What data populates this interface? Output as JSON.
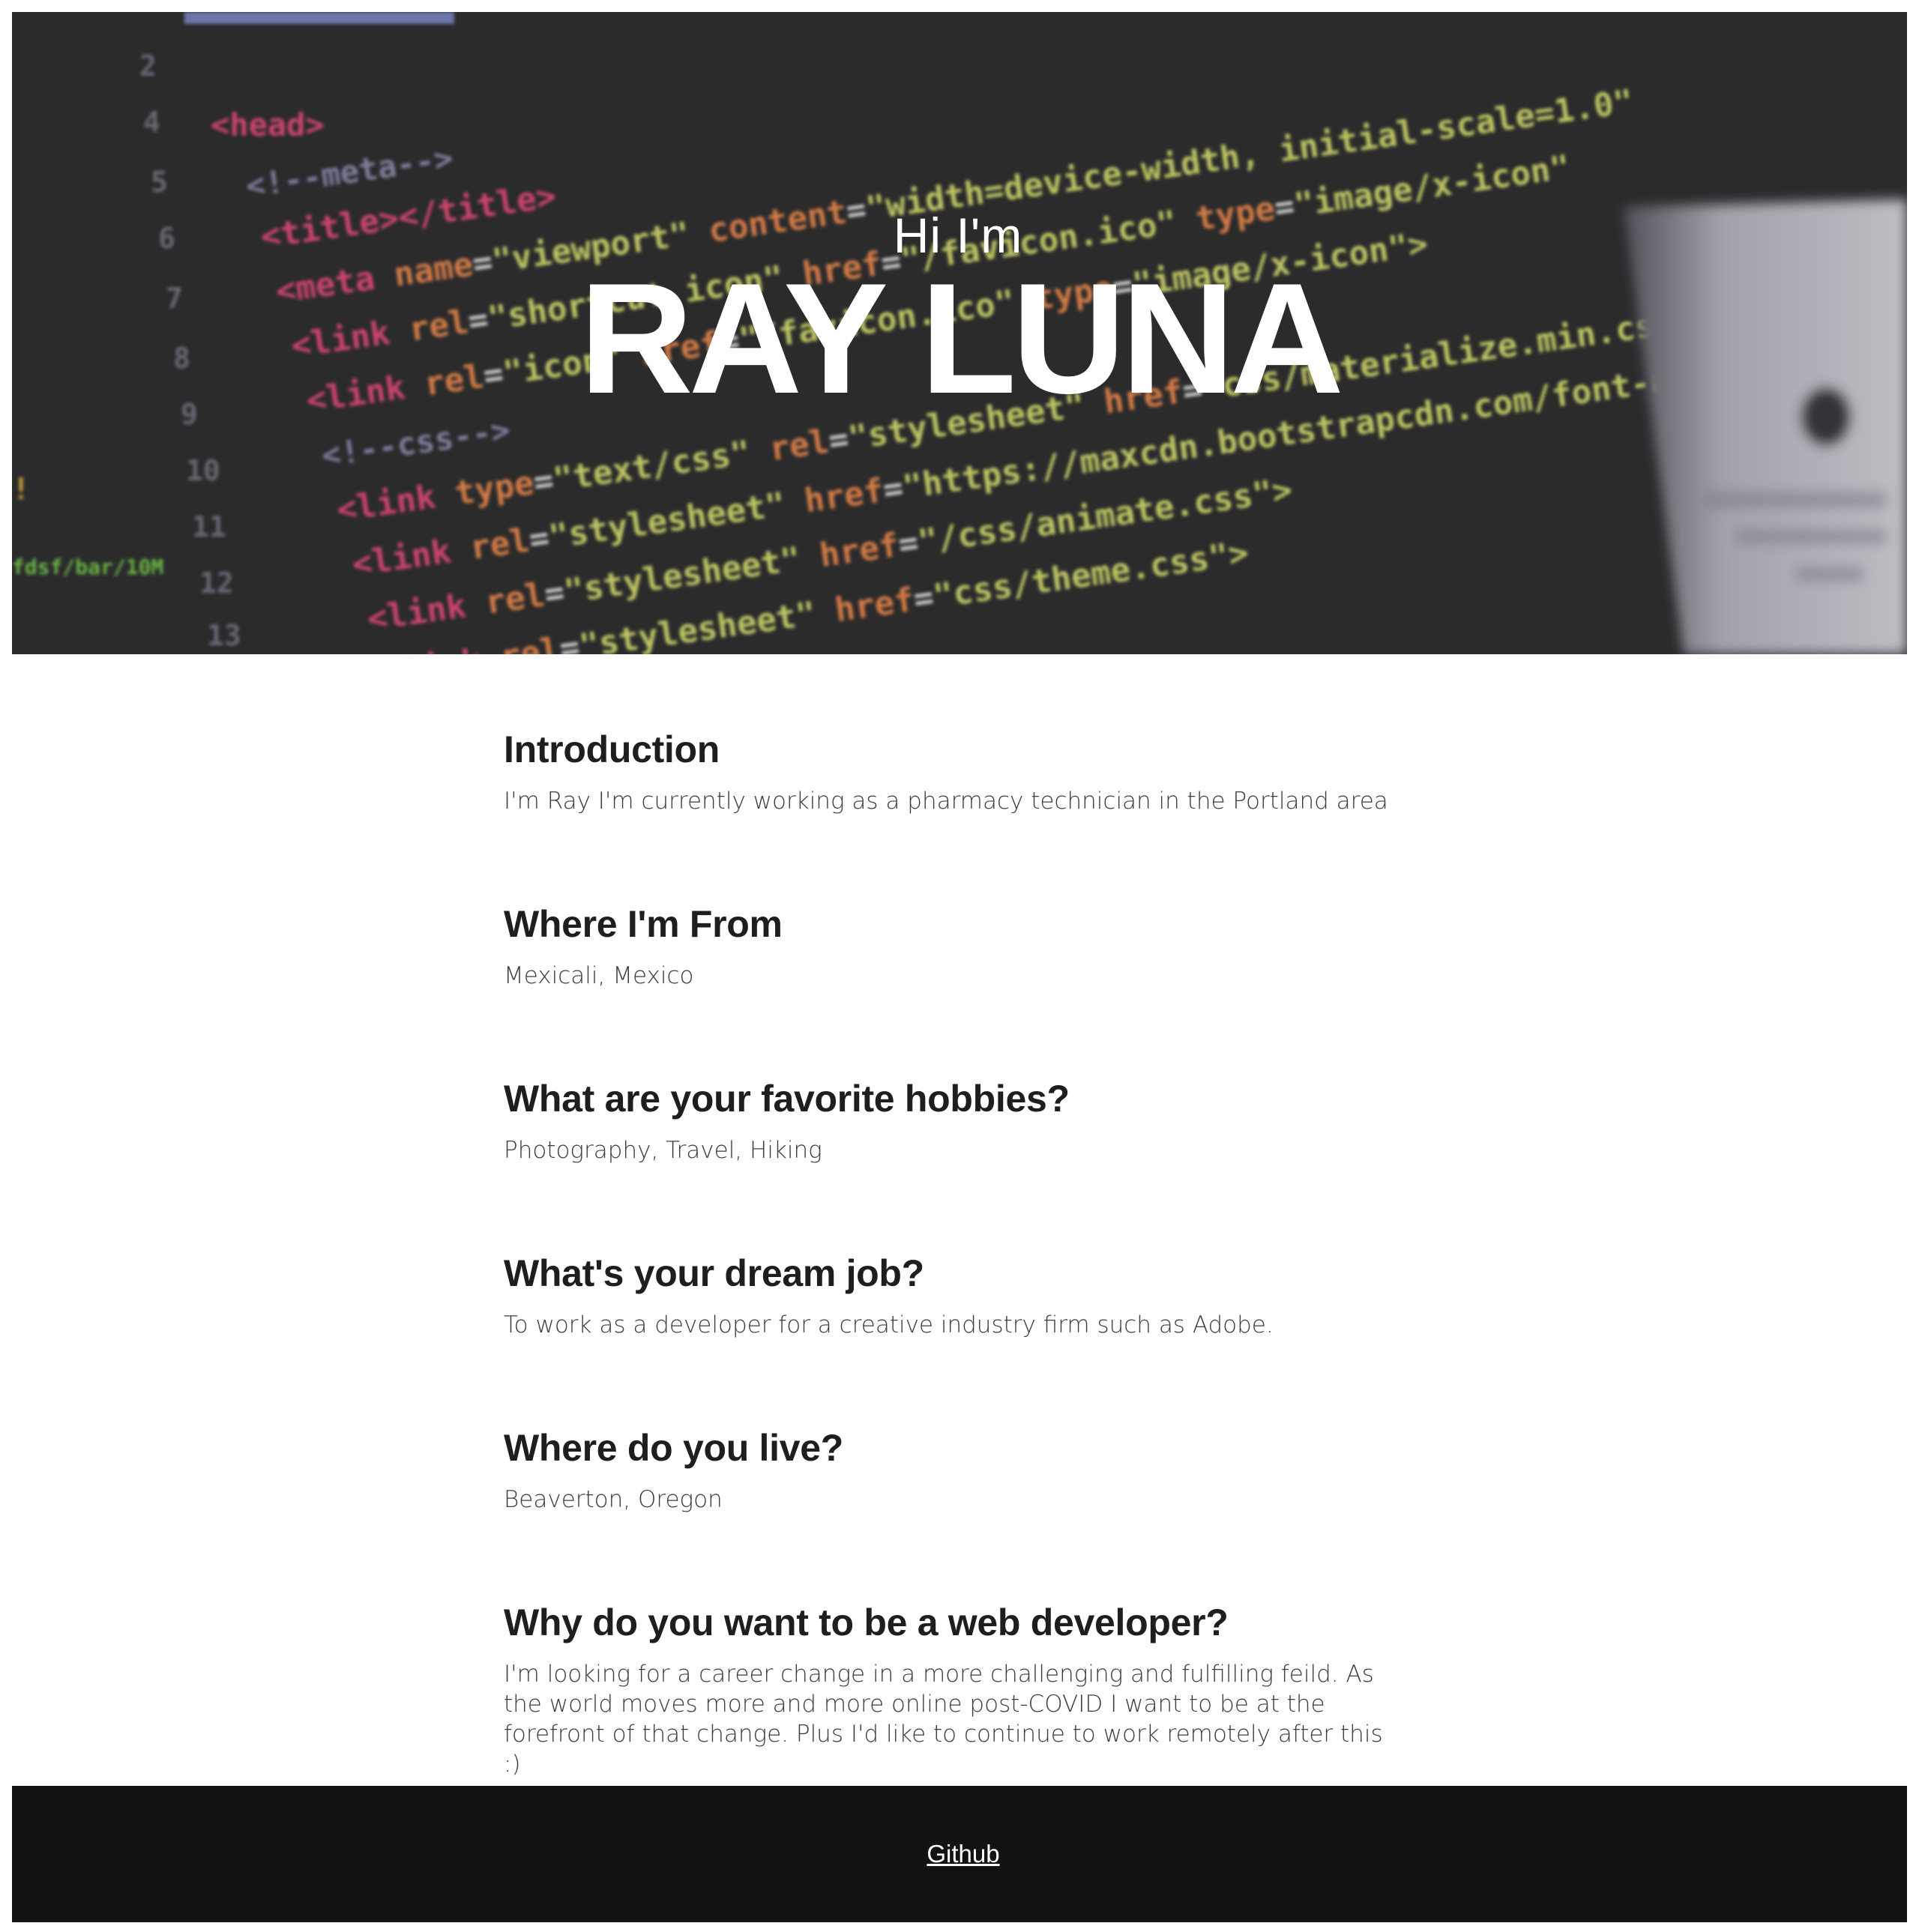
{
  "hero": {
    "greeting": "Hi I'm",
    "name": "RAY LUNA",
    "background_image": "blurred-code-editor-photo"
  },
  "sections": [
    {
      "heading": "Introduction",
      "body": "I'm Ray I'm currently working as a pharmacy technician in the Portland area"
    },
    {
      "heading": "Where I'm From",
      "body": "Mexicali, Mexico"
    },
    {
      "heading": "What are your favorite hobbies?",
      "body": "Photography, Travel, Hiking"
    },
    {
      "heading": "What's your dream job?",
      "body": "To work as a developer for a creative industry firm such as Adobe."
    },
    {
      "heading": "Where do you live?",
      "body": "Beaverton, Oregon"
    },
    {
      "heading": "Why do you want to be a web developer?",
      "body": "I'm looking for a career change in a more challenging and fulfilling feild. As the world moves more and more online post-COVID I want to be at the forefront of that change. Plus I'd like to continue to work remotely after this :)"
    }
  ],
  "footer": {
    "link_label": "Github"
  },
  "colors": {
    "hero_bg": "#2f2f31",
    "footer_bg": "#121212",
    "heading": "#1e1e1e",
    "body_text": "#3c3c3c"
  }
}
